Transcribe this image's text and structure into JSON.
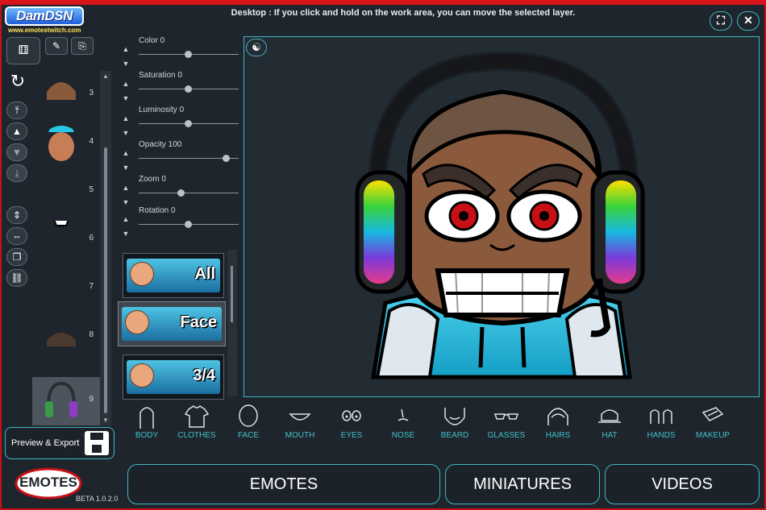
{
  "app": {
    "logo_text": "DamDSN",
    "logo_url": "www.emotestwitch.com",
    "hint": "Desktop : If you click and hold on the work area, you can move the selected layer.",
    "logo2_text": "EMOTES",
    "version": "BETA 1.0.2.0"
  },
  "window_buttons": {
    "fullscreen_icon": "⛶",
    "close_icon": "✕"
  },
  "layers": [
    {
      "num": "3"
    },
    {
      "num": "4"
    },
    {
      "num": "5"
    },
    {
      "num": "6"
    },
    {
      "num": "7"
    },
    {
      "num": "8"
    },
    {
      "num": "9",
      "selected": true
    }
  ],
  "sliders": [
    {
      "label": "Color 0",
      "value": 0
    },
    {
      "label": "Saturation 0",
      "value": 0
    },
    {
      "label": "Luminosity 0",
      "value": 0
    },
    {
      "label": "Opacity 100",
      "value": 100
    },
    {
      "label": "Zoom 0",
      "value": 0
    },
    {
      "label": "Rotation 0",
      "value": 0
    }
  ],
  "categories": [
    {
      "label": "All"
    },
    {
      "label": "Face",
      "selected": true
    },
    {
      "label": "3/4"
    }
  ],
  "preview_export": "Preview & Export",
  "parts": [
    {
      "label": "BODY",
      "icon": "body-icon"
    },
    {
      "label": "CLOTHES",
      "icon": "shirt-icon"
    },
    {
      "label": "FACE",
      "icon": "face-icon"
    },
    {
      "label": "MOUTH",
      "icon": "mouth-icon"
    },
    {
      "label": "EYES",
      "icon": "eyes-icon"
    },
    {
      "label": "NOSE",
      "icon": "nose-icon"
    },
    {
      "label": "BEARD",
      "icon": "beard-icon"
    },
    {
      "label": "GLASSES",
      "icon": "glasses-icon"
    },
    {
      "label": "HAIRS",
      "icon": "hair-icon"
    },
    {
      "label": "HAT",
      "icon": "hat-icon"
    },
    {
      "label": "HANDS",
      "icon": "hands-icon"
    },
    {
      "label": "MAKEUP",
      "icon": "makeup-icon"
    }
  ],
  "tabs": [
    {
      "label": "EMOTES"
    },
    {
      "label": "MINIATURES"
    },
    {
      "label": "VIDEOS"
    }
  ],
  "colors": {
    "accent": "#3fb6c5",
    "brand_red": "#d8141b",
    "background": "#1f252c"
  }
}
